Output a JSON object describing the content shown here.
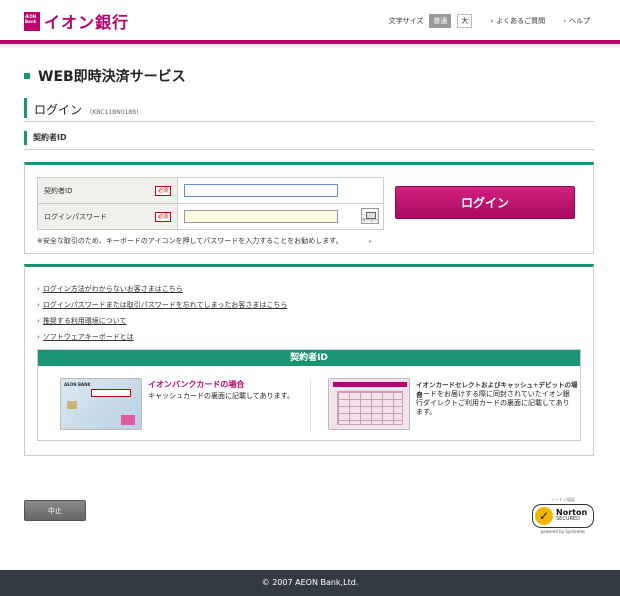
{
  "header": {
    "logo_mark": "ÆON Bank",
    "logo_text": "イオン銀行",
    "text_size_label": "文字サイズ",
    "size_normal": "普通",
    "size_large": "大",
    "faq_link": "よくあるご質問",
    "help_link": "ヘルプ"
  },
  "page": {
    "title": "WEB即時決済サービス",
    "subtitle": "ログイン",
    "screen_code": "(KBC11BN018B)",
    "section_title": "契約者ID"
  },
  "login": {
    "id_label": "契約者ID",
    "password_label": "ログインパスワード",
    "required_badge": "必須",
    "id_value": "",
    "password_value": "",
    "keyboard_label": "キーボード",
    "login_button": "ログイン",
    "note": "※安全な取引のため、キーボードのアイコンを押してパスワードを入力することをお勧めします。"
  },
  "info": {
    "links": [
      "ログイン方法がわからないお客さまはこちら",
      "ログインパスワードまたは取引パスワードを忘れてしまったお客さまはこちら",
      "推奨する利用環境について",
      "ソフトウェアキーボードとは"
    ],
    "id_box_title": "契約者ID",
    "card1_bank": "AEON BANK",
    "card1_title": "イオンバンクカードの場合",
    "card1_desc": "キャッシュカードの裏面に記載してあります。",
    "card2_title_a": "イオンカードセレクトおよびキャッシュ+デビットの場合",
    "card2_desc": "カードをお届けする際に同封されていたイオン銀行ダイレクトご利用カードの裏面に記載してあります。"
  },
  "bottom": {
    "cancel_button": "中止",
    "norton_checked": "ノートン認証",
    "norton_name": "Norton",
    "norton_secured": "SECURED",
    "norton_powered": "powered by Symantec"
  },
  "footer": {
    "copyright": "© 2007 AEON Bank,Ltd."
  }
}
